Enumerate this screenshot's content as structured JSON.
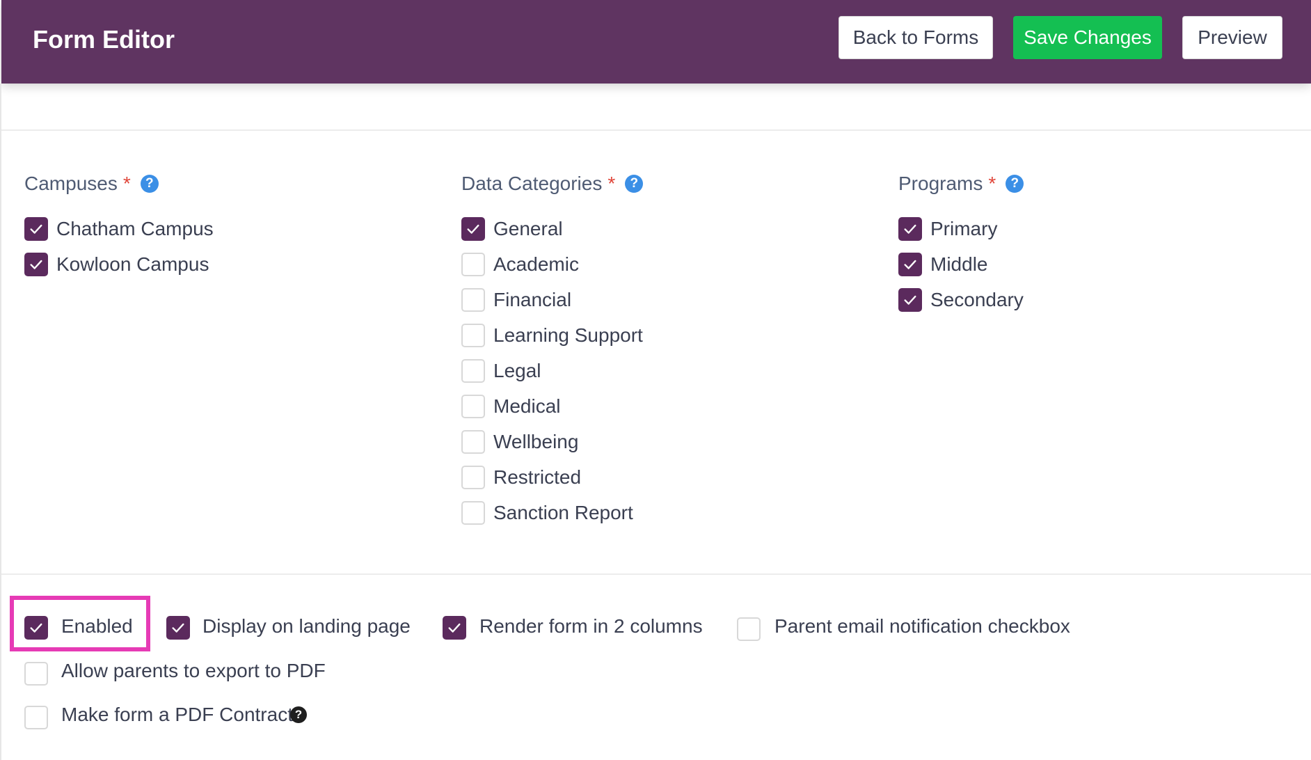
{
  "header": {
    "title": "Form Editor",
    "back_label": "Back to Forms",
    "save_label": "Save Changes",
    "preview_label": "Preview",
    "bg_color": "#5f3461",
    "save_color": "#14bf52"
  },
  "sections": {
    "campuses": {
      "title": "Campuses",
      "required_mark": "*",
      "help_icon": "?",
      "items": [
        {
          "label": "Chatham Campus",
          "checked": true
        },
        {
          "label": "Kowloon Campus",
          "checked": true
        }
      ]
    },
    "data_categories": {
      "title": "Data Categories",
      "required_mark": "*",
      "help_icon": "?",
      "items": [
        {
          "label": "General",
          "checked": true
        },
        {
          "label": "Academic",
          "checked": false
        },
        {
          "label": "Financial",
          "checked": false
        },
        {
          "label": "Learning Support",
          "checked": false
        },
        {
          "label": "Legal",
          "checked": false
        },
        {
          "label": "Medical",
          "checked": false
        },
        {
          "label": "Wellbeing",
          "checked": false
        },
        {
          "label": "Restricted",
          "checked": false
        },
        {
          "label": "Sanction Report",
          "checked": false
        }
      ]
    },
    "programs": {
      "title": "Programs",
      "required_mark": "*",
      "help_icon": "?",
      "items": [
        {
          "label": "Primary",
          "checked": true
        },
        {
          "label": "Middle",
          "checked": true
        },
        {
          "label": "Secondary",
          "checked": true
        }
      ]
    }
  },
  "options": {
    "enabled": {
      "label": "Enabled",
      "checked": true
    },
    "display_landing": {
      "label": "Display on landing page",
      "checked": true
    },
    "two_columns": {
      "label": "Render form in 2 columns",
      "checked": true
    },
    "parent_email": {
      "label": "Parent email notification checkbox",
      "checked": false
    },
    "export_pdf": {
      "label": "Allow parents to export to PDF",
      "checked": false
    },
    "pdf_contract": {
      "label": "Make form a PDF Contract",
      "checked": false,
      "help_icon": "?"
    }
  },
  "colors": {
    "checkbox_checked": "#5b2a5d",
    "required": "#e0463a",
    "help": "#3b8fe6",
    "highlight": "#e63bb5"
  }
}
